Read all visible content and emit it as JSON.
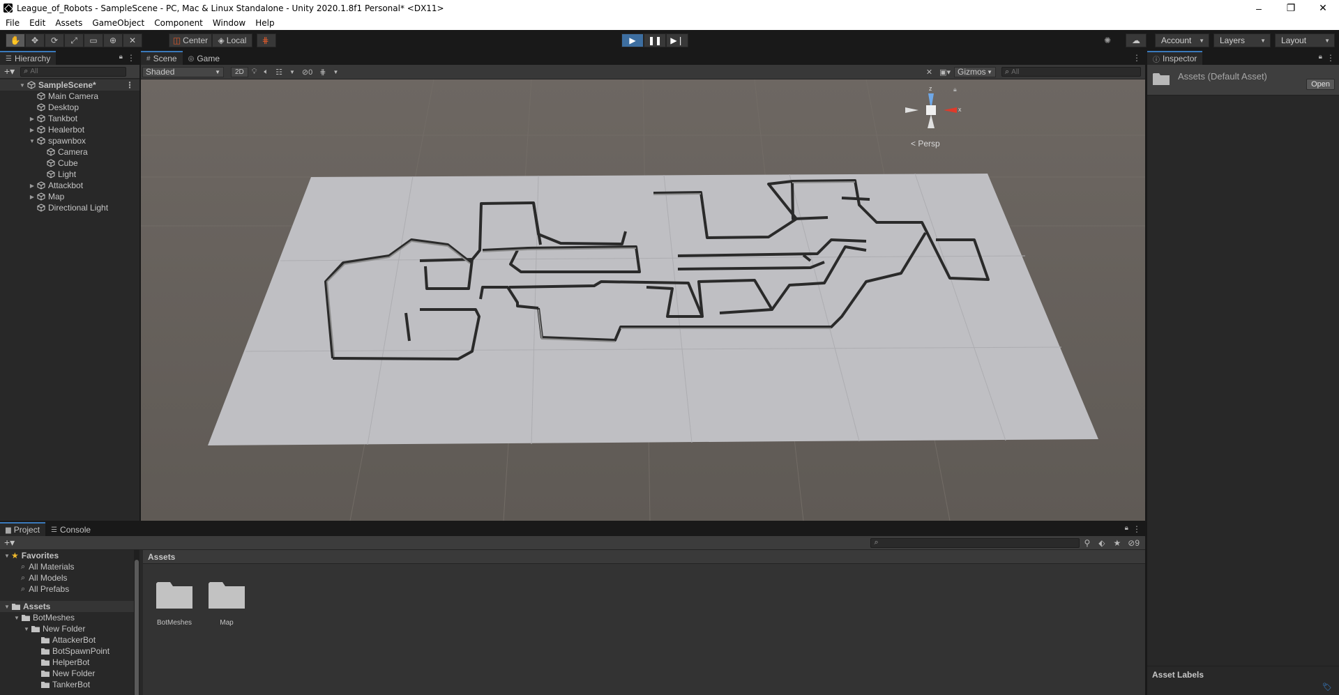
{
  "window": {
    "title": "League_of_Robots - SampleScene - PC, Mac & Linux Standalone - Unity 2020.1.8f1 Personal* <DX11>",
    "minimize": "–",
    "restore": "❐",
    "close": "✕"
  },
  "menu": [
    "File",
    "Edit",
    "Assets",
    "GameObject",
    "Component",
    "Window",
    "Help"
  ],
  "toolbar": {
    "pivot_label": "Center",
    "space_label": "Local",
    "account_label": "Account",
    "layers_label": "Layers",
    "layout_label": "Layout"
  },
  "hierarchy": {
    "tab_label": "Hierarchy",
    "search_placeholder": "All",
    "items": [
      {
        "label": "SampleScene*",
        "depth": 0,
        "expand": "open",
        "kind": "scene"
      },
      {
        "label": "Main Camera",
        "depth": 1,
        "expand": "none"
      },
      {
        "label": "Desktop",
        "depth": 1,
        "expand": "none"
      },
      {
        "label": "Tankbot",
        "depth": 1,
        "expand": "closed"
      },
      {
        "label": "Healerbot",
        "depth": 1,
        "expand": "closed"
      },
      {
        "label": "spawnbox",
        "depth": 1,
        "expand": "open"
      },
      {
        "label": "Camera",
        "depth": 2,
        "expand": "none"
      },
      {
        "label": "Cube",
        "depth": 2,
        "expand": "none"
      },
      {
        "label": "Light",
        "depth": 2,
        "expand": "none"
      },
      {
        "label": "Attackbot",
        "depth": 1,
        "expand": "closed"
      },
      {
        "label": "Map",
        "depth": 1,
        "expand": "closed"
      },
      {
        "label": "Directional Light",
        "depth": 1,
        "expand": "none"
      }
    ]
  },
  "scene": {
    "tab_scene": "Scene",
    "tab_game": "Game",
    "shading_mode": "Shaded",
    "mode_2d": "2D",
    "hidden_count": "0",
    "gizmos_label": "Gizmos",
    "search_placeholder": "All",
    "persp_label": "< Persp",
    "axis_x": "x",
    "axis_z": "z"
  },
  "inspector": {
    "tab_label": "Inspector",
    "asset_name": "Assets (Default Asset)",
    "open_label": "Open",
    "asset_labels": "Asset Labels"
  },
  "project": {
    "tab_project": "Project",
    "tab_console": "Console",
    "hidden_count": "9",
    "favorites_label": "Favorites",
    "favorites": [
      "All Materials",
      "All Models",
      "All Prefabs"
    ],
    "assets_label": "Assets",
    "tree": [
      {
        "label": "BotMeshes",
        "depth": 1,
        "expand": "open"
      },
      {
        "label": "New Folder",
        "depth": 2,
        "expand": "open"
      },
      {
        "label": "AttackerBot",
        "depth": 3,
        "expand": "none"
      },
      {
        "label": "BotSpawnPoint",
        "depth": 3,
        "expand": "none"
      },
      {
        "label": "HelperBot",
        "depth": 3,
        "expand": "none"
      },
      {
        "label": "New Folder",
        "depth": 3,
        "expand": "none"
      },
      {
        "label": "TankerBot",
        "depth": 3,
        "expand": "none"
      }
    ],
    "breadcrumb": "Assets",
    "assets": [
      "BotMeshes",
      "Map"
    ]
  },
  "colors": {
    "accent": "#3a79bb",
    "panel": "#282828",
    "play_active": "#3d6ea0",
    "gizmo_x": "#e03a2a",
    "gizmo_z": "#6fa8e8",
    "favorite_star": "#f0b92c"
  }
}
